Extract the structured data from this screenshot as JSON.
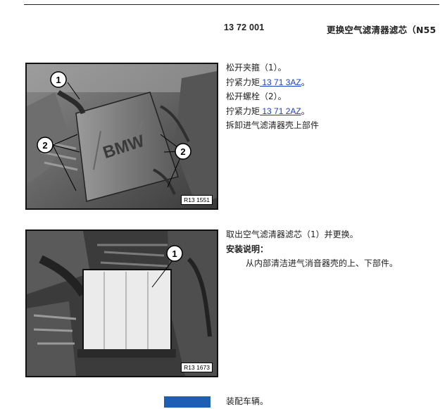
{
  "header": {
    "number": "13 72 001",
    "title": "更换空气滤清器滤芯（N55"
  },
  "figure1": {
    "ref": "R13 1551",
    "engine_text": "BMW",
    "callouts": [
      "1",
      "2",
      "2"
    ]
  },
  "figure2": {
    "ref": "R13 1673",
    "callouts": [
      "1"
    ]
  },
  "steps1": {
    "line1": "松开夹箍（1）。",
    "line2_prefix": "拧紧力矩",
    "line2_link": " 13 71 3AZ",
    "line2_suffix": "。",
    "line3": "松开螺栓（2）。",
    "line4_prefix": "拧紧力矩",
    "line4_link": " 13 71 2AZ",
    "line4_suffix": "。",
    "line5": "拆卸进气滤清器壳上部件"
  },
  "steps2": {
    "line1": "取出空气滤清器滤芯（1）并更换。",
    "install_heading": "安装说明：",
    "install_text": "从内部清洁进气消音器壳的上、下部件。"
  },
  "footer": {
    "text": "装配车辆。"
  }
}
